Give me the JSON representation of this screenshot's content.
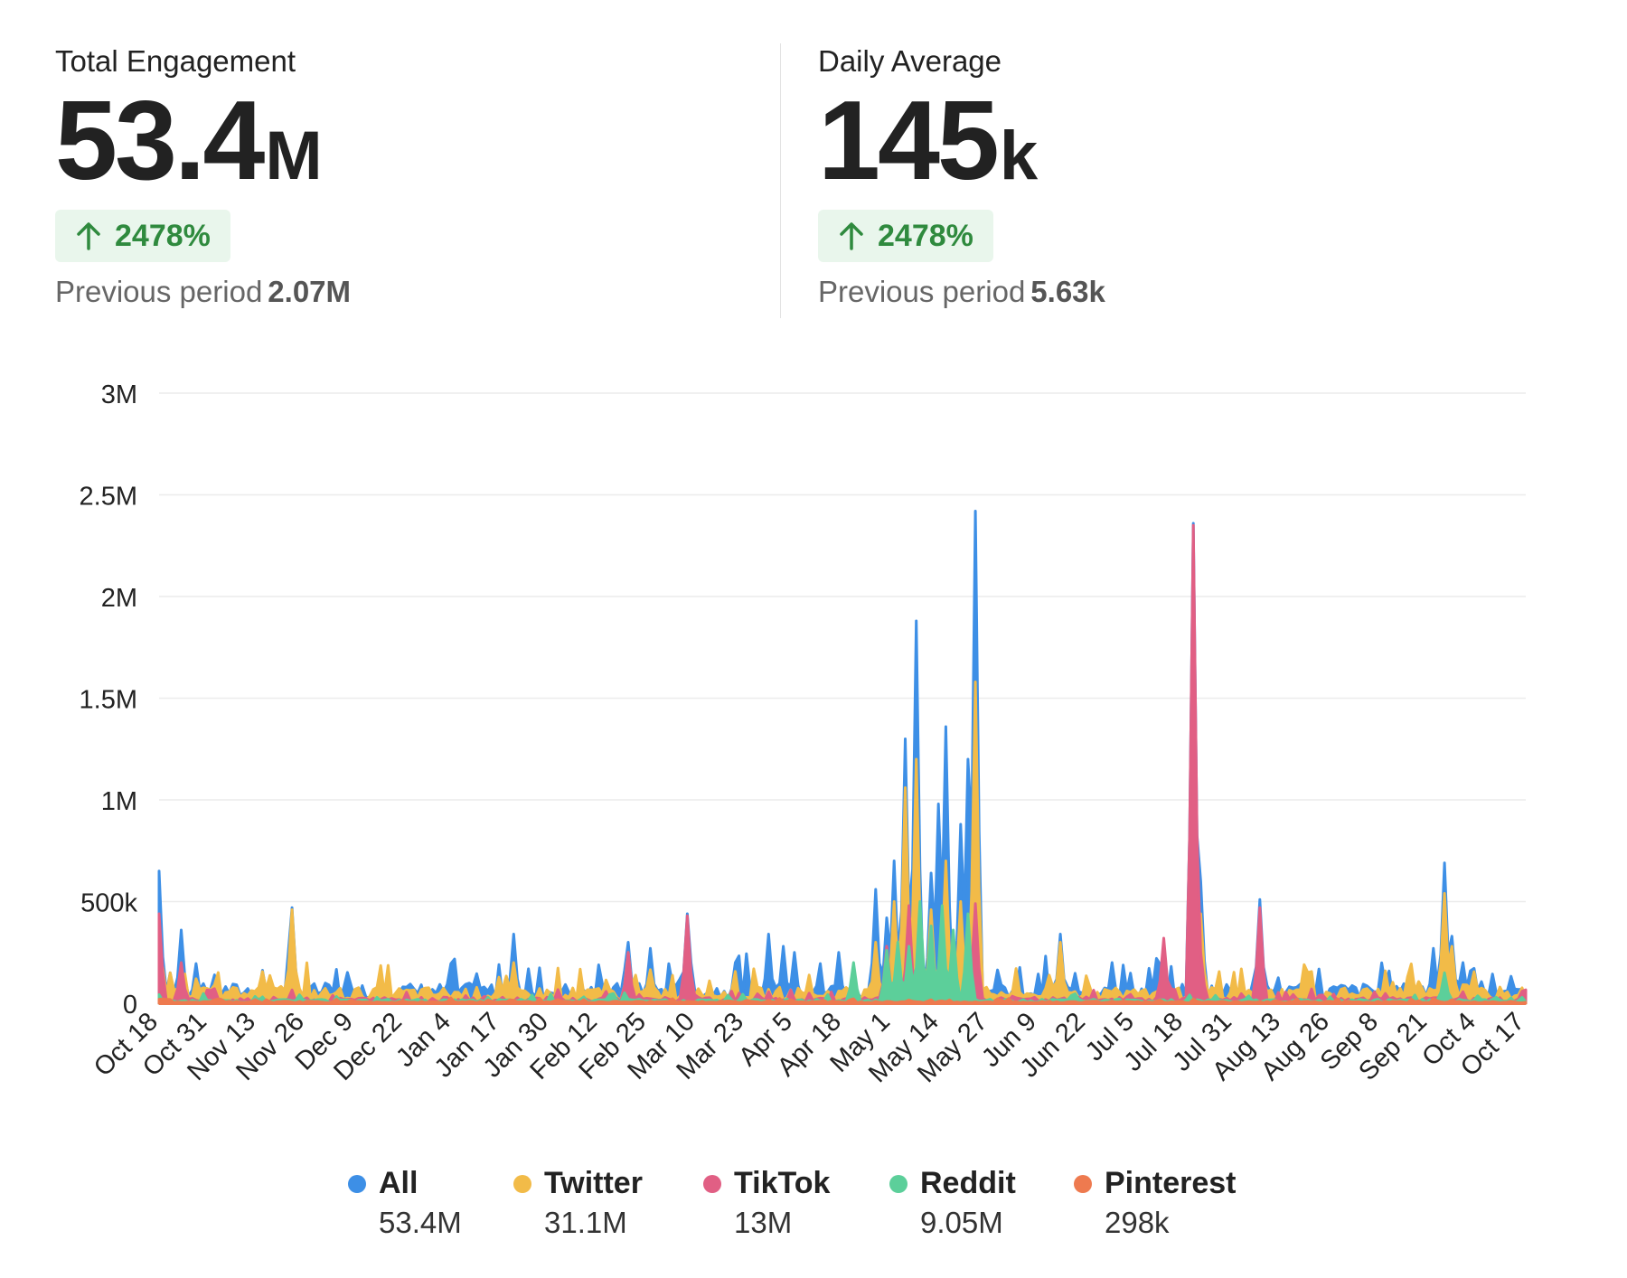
{
  "stats": [
    {
      "title": "Total Engagement",
      "number": "53.4",
      "unit": "M",
      "change": "2478%",
      "prev_label": "Previous period",
      "prev_value": "2.07M"
    },
    {
      "title": "Daily Average",
      "number": "145",
      "unit": "k",
      "change": "2478%",
      "prev_label": "Previous period",
      "prev_value": "5.63k"
    }
  ],
  "colors": {
    "change_positive": "#2f8a3e",
    "change_bg": "#e9f6ec",
    "grid": "#ececec"
  },
  "chart_data": {
    "type": "area",
    "ylim": [
      0,
      3000000
    ],
    "yticks": [
      {
        "value": 0,
        "label": "0"
      },
      {
        "value": 500000,
        "label": "500k"
      },
      {
        "value": 1000000,
        "label": "1M"
      },
      {
        "value": 1500000,
        "label": "1.5M"
      },
      {
        "value": 2000000,
        "label": "2M"
      },
      {
        "value": 2500000,
        "label": "2.5M"
      },
      {
        "value": 3000000,
        "label": "3M"
      }
    ],
    "x_range": [
      "Oct 18",
      "Oct 22 (next year)"
    ],
    "xticks": [
      "Oct 18",
      "Oct 31",
      "Nov 13",
      "Nov 26",
      "Dec 9",
      "Dec 22",
      "Jan 4",
      "Jan 17",
      "Jan 30",
      "Feb 12",
      "Feb 25",
      "Mar 10",
      "Mar 23",
      "Apr 5",
      "Apr 18",
      "May 1",
      "May 14",
      "May 27",
      "Jun 9",
      "Jun 22",
      "Jul 5",
      "Jul 18",
      "Jul 31",
      "Aug 13",
      "Aug 26",
      "Sep 8",
      "Sep 21",
      "Oct 4",
      "Oct 17"
    ],
    "grid": true,
    "legend_position": "bottom",
    "series": [
      {
        "name": "All",
        "total": "53.4M",
        "color": "#3d8fe6",
        "peaks": [
          [
            "Oct 18",
            650000
          ],
          [
            "Oct 24",
            360000
          ],
          [
            "Oct 28",
            190000
          ],
          [
            "Nov 23",
            470000
          ],
          [
            "Jan 22",
            340000
          ],
          [
            "Feb 22",
            300000
          ],
          [
            "Feb 28",
            270000
          ],
          [
            "Mar 10",
            440000
          ],
          [
            "Mar 23",
            200000
          ],
          [
            "Apr 1",
            340000
          ],
          [
            "Apr 5",
            280000
          ],
          [
            "Apr 8",
            250000
          ],
          [
            "Apr 20",
            250000
          ],
          [
            "Apr 30",
            560000
          ],
          [
            "May 3",
            420000
          ],
          [
            "May 5",
            700000
          ],
          [
            "May 8",
            1300000
          ],
          [
            "May 11",
            1880000
          ],
          [
            "May 15",
            640000
          ],
          [
            "May 17",
            980000
          ],
          [
            "May 19",
            1360000
          ],
          [
            "May 23",
            880000
          ],
          [
            "May 25",
            1200000
          ],
          [
            "May 27",
            2420000
          ],
          [
            "Jun 19",
            340000
          ],
          [
            "Jul 3",
            200000
          ],
          [
            "Jul 25",
            2360000
          ],
          [
            "Jul 27",
            600000
          ],
          [
            "Aug 12",
            510000
          ],
          [
            "Sep 28",
            270000
          ],
          [
            "Oct 1",
            690000
          ],
          [
            "Oct 3",
            330000
          ],
          [
            "Oct 6",
            200000
          ],
          [
            "Oct 19",
            130000
          ]
        ],
        "baseline": 50000
      },
      {
        "name": "Twitter",
        "total": "31.1M",
        "color": "#f2bb48",
        "peaks": [
          [
            "Nov 23",
            460000
          ],
          [
            "Jan 22",
            200000
          ],
          [
            "Feb 22",
            250000
          ],
          [
            "Apr 30",
            300000
          ],
          [
            "May 5",
            500000
          ],
          [
            "May 8",
            1060000
          ],
          [
            "May 11",
            1200000
          ],
          [
            "May 15",
            460000
          ],
          [
            "May 19",
            700000
          ],
          [
            "May 23",
            500000
          ],
          [
            "May 27",
            1580000
          ],
          [
            "Jun 19",
            300000
          ],
          [
            "Jul 27",
            440000
          ],
          [
            "Aug 24",
            190000
          ],
          [
            "Oct 1",
            540000
          ],
          [
            "Oct 3",
            280000
          ]
        ],
        "baseline": 40000
      },
      {
        "name": "TikTok",
        "total": "13M",
        "color": "#e15f84",
        "peaks": [
          [
            "Oct 18",
            440000
          ],
          [
            "Oct 24",
            200000
          ],
          [
            "Feb 22",
            250000
          ],
          [
            "Mar 10",
            430000
          ],
          [
            "May 3",
            280000
          ],
          [
            "May 9",
            480000
          ],
          [
            "May 27",
            490000
          ],
          [
            "Jul 17",
            320000
          ],
          [
            "Jul 25",
            2350000
          ],
          [
            "Jul 27",
            250000
          ],
          [
            "Aug 12",
            470000
          ]
        ],
        "baseline": 15000
      },
      {
        "name": "Reddit",
        "total": "9.05M",
        "color": "#5ccf9a",
        "peaks": [
          [
            "Apr 24",
            200000
          ],
          [
            "May 3",
            260000
          ],
          [
            "May 6",
            300000
          ],
          [
            "May 9",
            280000
          ],
          [
            "May 12",
            500000
          ],
          [
            "May 15",
            380000
          ],
          [
            "May 18",
            480000
          ],
          [
            "May 21",
            360000
          ],
          [
            "May 25",
            440000
          ],
          [
            "Oct 1",
            150000
          ]
        ],
        "baseline": 10000
      },
      {
        "name": "Pinterest",
        "total": "298k",
        "color": "#ee7a4f",
        "peaks": [],
        "baseline": 5000
      }
    ]
  }
}
